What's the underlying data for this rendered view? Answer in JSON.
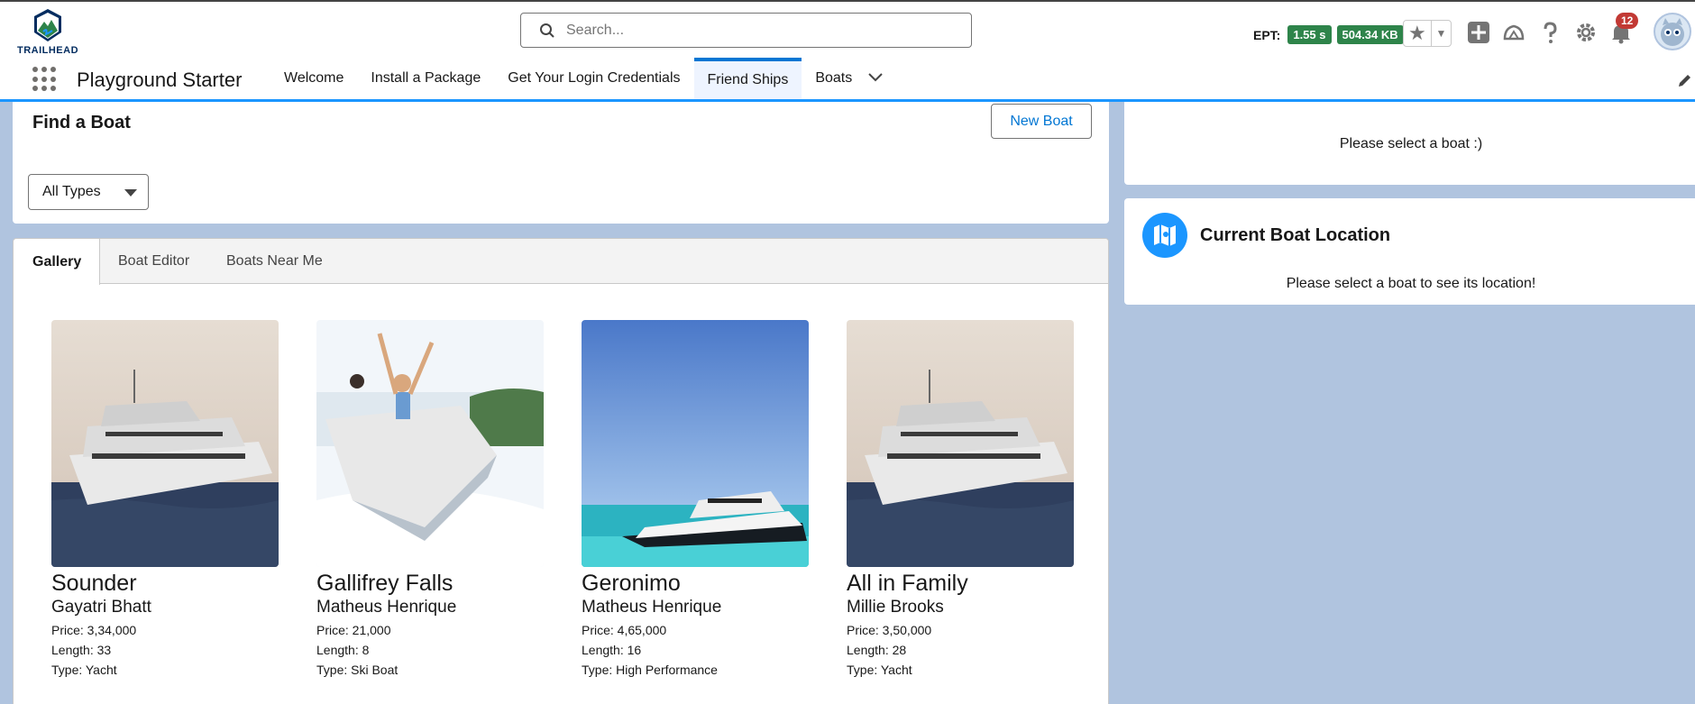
{
  "header": {
    "logo_text": "TRAILHEAD",
    "search_placeholder": "Search...",
    "ept_label": "EPT:",
    "ept_time": "1.55 s",
    "ept_size": "504.34 KB",
    "notification_count": "12"
  },
  "nav": {
    "app_name": "Playground Starter",
    "tabs": [
      {
        "label": "Welcome"
      },
      {
        "label": "Install a Package"
      },
      {
        "label": "Get Your Login Credentials"
      },
      {
        "label": "Friend Ships"
      },
      {
        "label": "Boats"
      }
    ],
    "active_tab": "Friend Ships"
  },
  "find_boat": {
    "title": "Find a Boat",
    "new_boat_label": "New Boat",
    "type_filter": "All Types"
  },
  "tabs": [
    {
      "label": "Gallery"
    },
    {
      "label": "Boat Editor"
    },
    {
      "label": "Boats Near Me"
    }
  ],
  "boats": [
    {
      "name": "Sounder",
      "owner": "Gayatri Bhatt",
      "price": "Price: 3,34,000",
      "length": "Length: 33",
      "type": "Type: Yacht"
    },
    {
      "name": "Gallifrey Falls",
      "owner": "Matheus Henrique",
      "price": "Price: 21,000",
      "length": "Length: 8",
      "type": "Type: Ski Boat"
    },
    {
      "name": "Geronimo",
      "owner": "Matheus Henrique",
      "price": "Price: 4,65,000",
      "length": "Length: 16",
      "type": "Type: High Performance"
    },
    {
      "name": "All in Family",
      "owner": "Millie Brooks",
      "price": "Price: 3,50,000",
      "length": "Length: 28",
      "type": "Type: Yacht"
    }
  ],
  "details": {
    "select_prompt": "Please select a boat :)"
  },
  "location": {
    "title": "Current Boat Location",
    "prompt": "Please select a boat to see its location!"
  },
  "colors": {
    "brand_blue": "#0176d3",
    "ept_green": "#2e844a",
    "notification_red": "#c23934",
    "page_background": "#b0c4df"
  }
}
